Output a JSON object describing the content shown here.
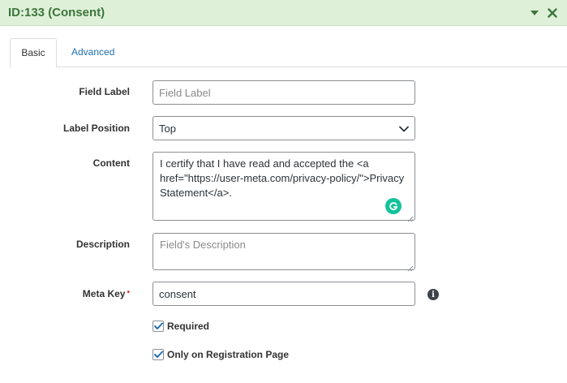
{
  "header": {
    "title": "ID:133 (Consent)"
  },
  "tabs": [
    {
      "label": "Basic",
      "active": true
    },
    {
      "label": "Advanced",
      "active": false
    }
  ],
  "fields": {
    "field_label": {
      "label": "Field Label",
      "placeholder": "Field Label",
      "value": ""
    },
    "label_position": {
      "label": "Label Position",
      "value": "Top"
    },
    "content": {
      "label": "Content",
      "value": "I certify that I have read and accepted the <a href=\"https://user-meta.com/privacy-policy/\">Privacy Statement</a>."
    },
    "description": {
      "label": "Description",
      "placeholder": "Field's Description",
      "value": ""
    },
    "meta_key": {
      "label": "Meta Key",
      "required_marker": "•",
      "value": "consent"
    }
  },
  "checkboxes": [
    {
      "label": "Required",
      "checked": true
    },
    {
      "label": "Only on Registration Page",
      "checked": true
    }
  ],
  "colors": {
    "header_bg": "#dff0d8",
    "header_text": "#3c763d",
    "link": "#2271b1",
    "grammarly": "#15c39a",
    "required": "#e03131"
  }
}
